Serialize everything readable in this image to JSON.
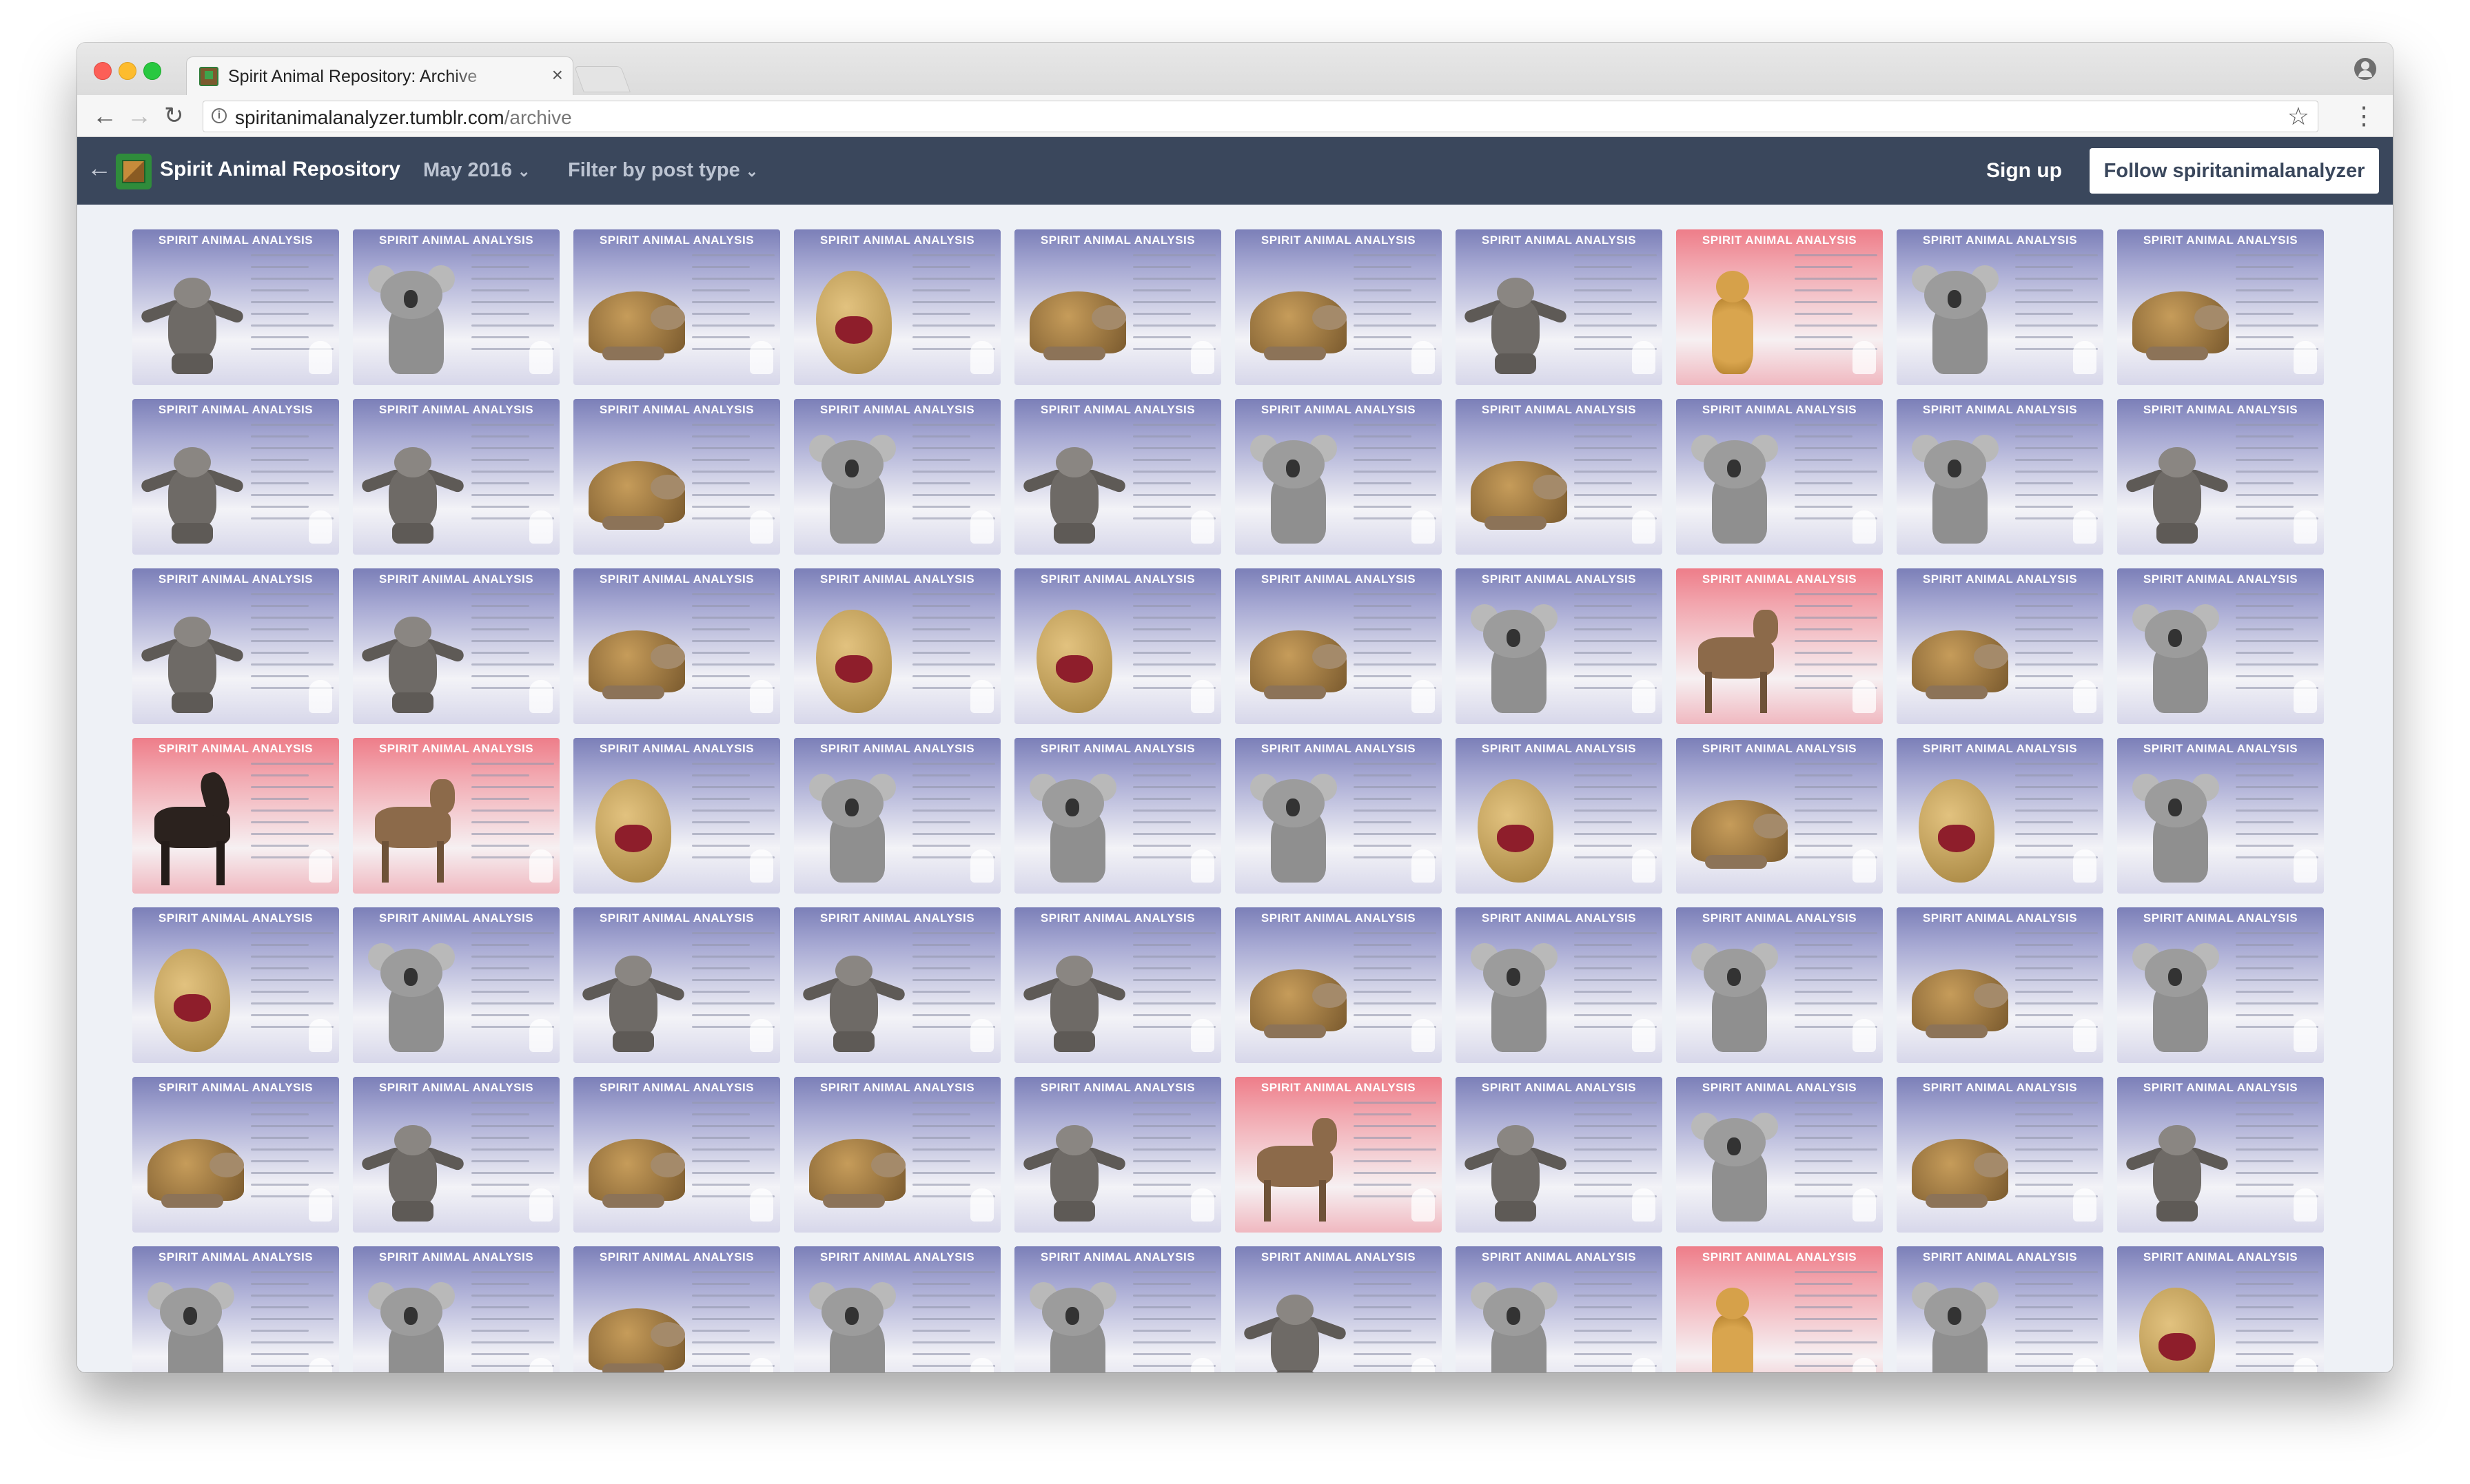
{
  "browser": {
    "tab_title": "Spirit Animal Repository: Archive",
    "tab_close": "×",
    "url_host": "spiritanimalanalyzer.tumblr.com",
    "url_path": "/archive"
  },
  "site": {
    "back_arrow": "←",
    "blog_name": "Spirit Animal Repository",
    "date_filter": "May 2016",
    "type_filter": "Filter by post type",
    "sign_up": "Sign up",
    "follow": "Follow spiritanimalanalyzer"
  },
  "card_title": "SPIRIT ANIMAL ANALYSIS",
  "grid": [
    [
      "sloth",
      "koala",
      "tortoise",
      "potato",
      "tortoise",
      "tortoise",
      "sloth",
      "cheetah-pink",
      "koala",
      "tortoise"
    ],
    [
      "sloth",
      "sloth",
      "tortoise",
      "koala",
      "sloth",
      "koala",
      "tortoise",
      "koala",
      "koala",
      "sloth"
    ],
    [
      "sloth",
      "sloth",
      "tortoise",
      "potato",
      "potato",
      "tortoise",
      "koala",
      "goat-pink",
      "tortoise",
      "koala"
    ],
    [
      "horse-pink",
      "goat-pink",
      "potato",
      "koala",
      "koala",
      "koala",
      "potato",
      "tortoise",
      "potato",
      "koala"
    ],
    [
      "potato",
      "koala",
      "sloth",
      "sloth",
      "sloth",
      "tortoise",
      "koala",
      "koala",
      "tortoise",
      "koala"
    ],
    [
      "tortoise",
      "sloth",
      "tortoise",
      "tortoise",
      "sloth",
      "goat-pink",
      "sloth",
      "koala",
      "tortoise",
      "sloth"
    ],
    [
      "koala",
      "koala",
      "tortoise",
      "koala",
      "koala",
      "sloth",
      "koala",
      "cheetah-pink",
      "koala",
      "potato"
    ]
  ]
}
